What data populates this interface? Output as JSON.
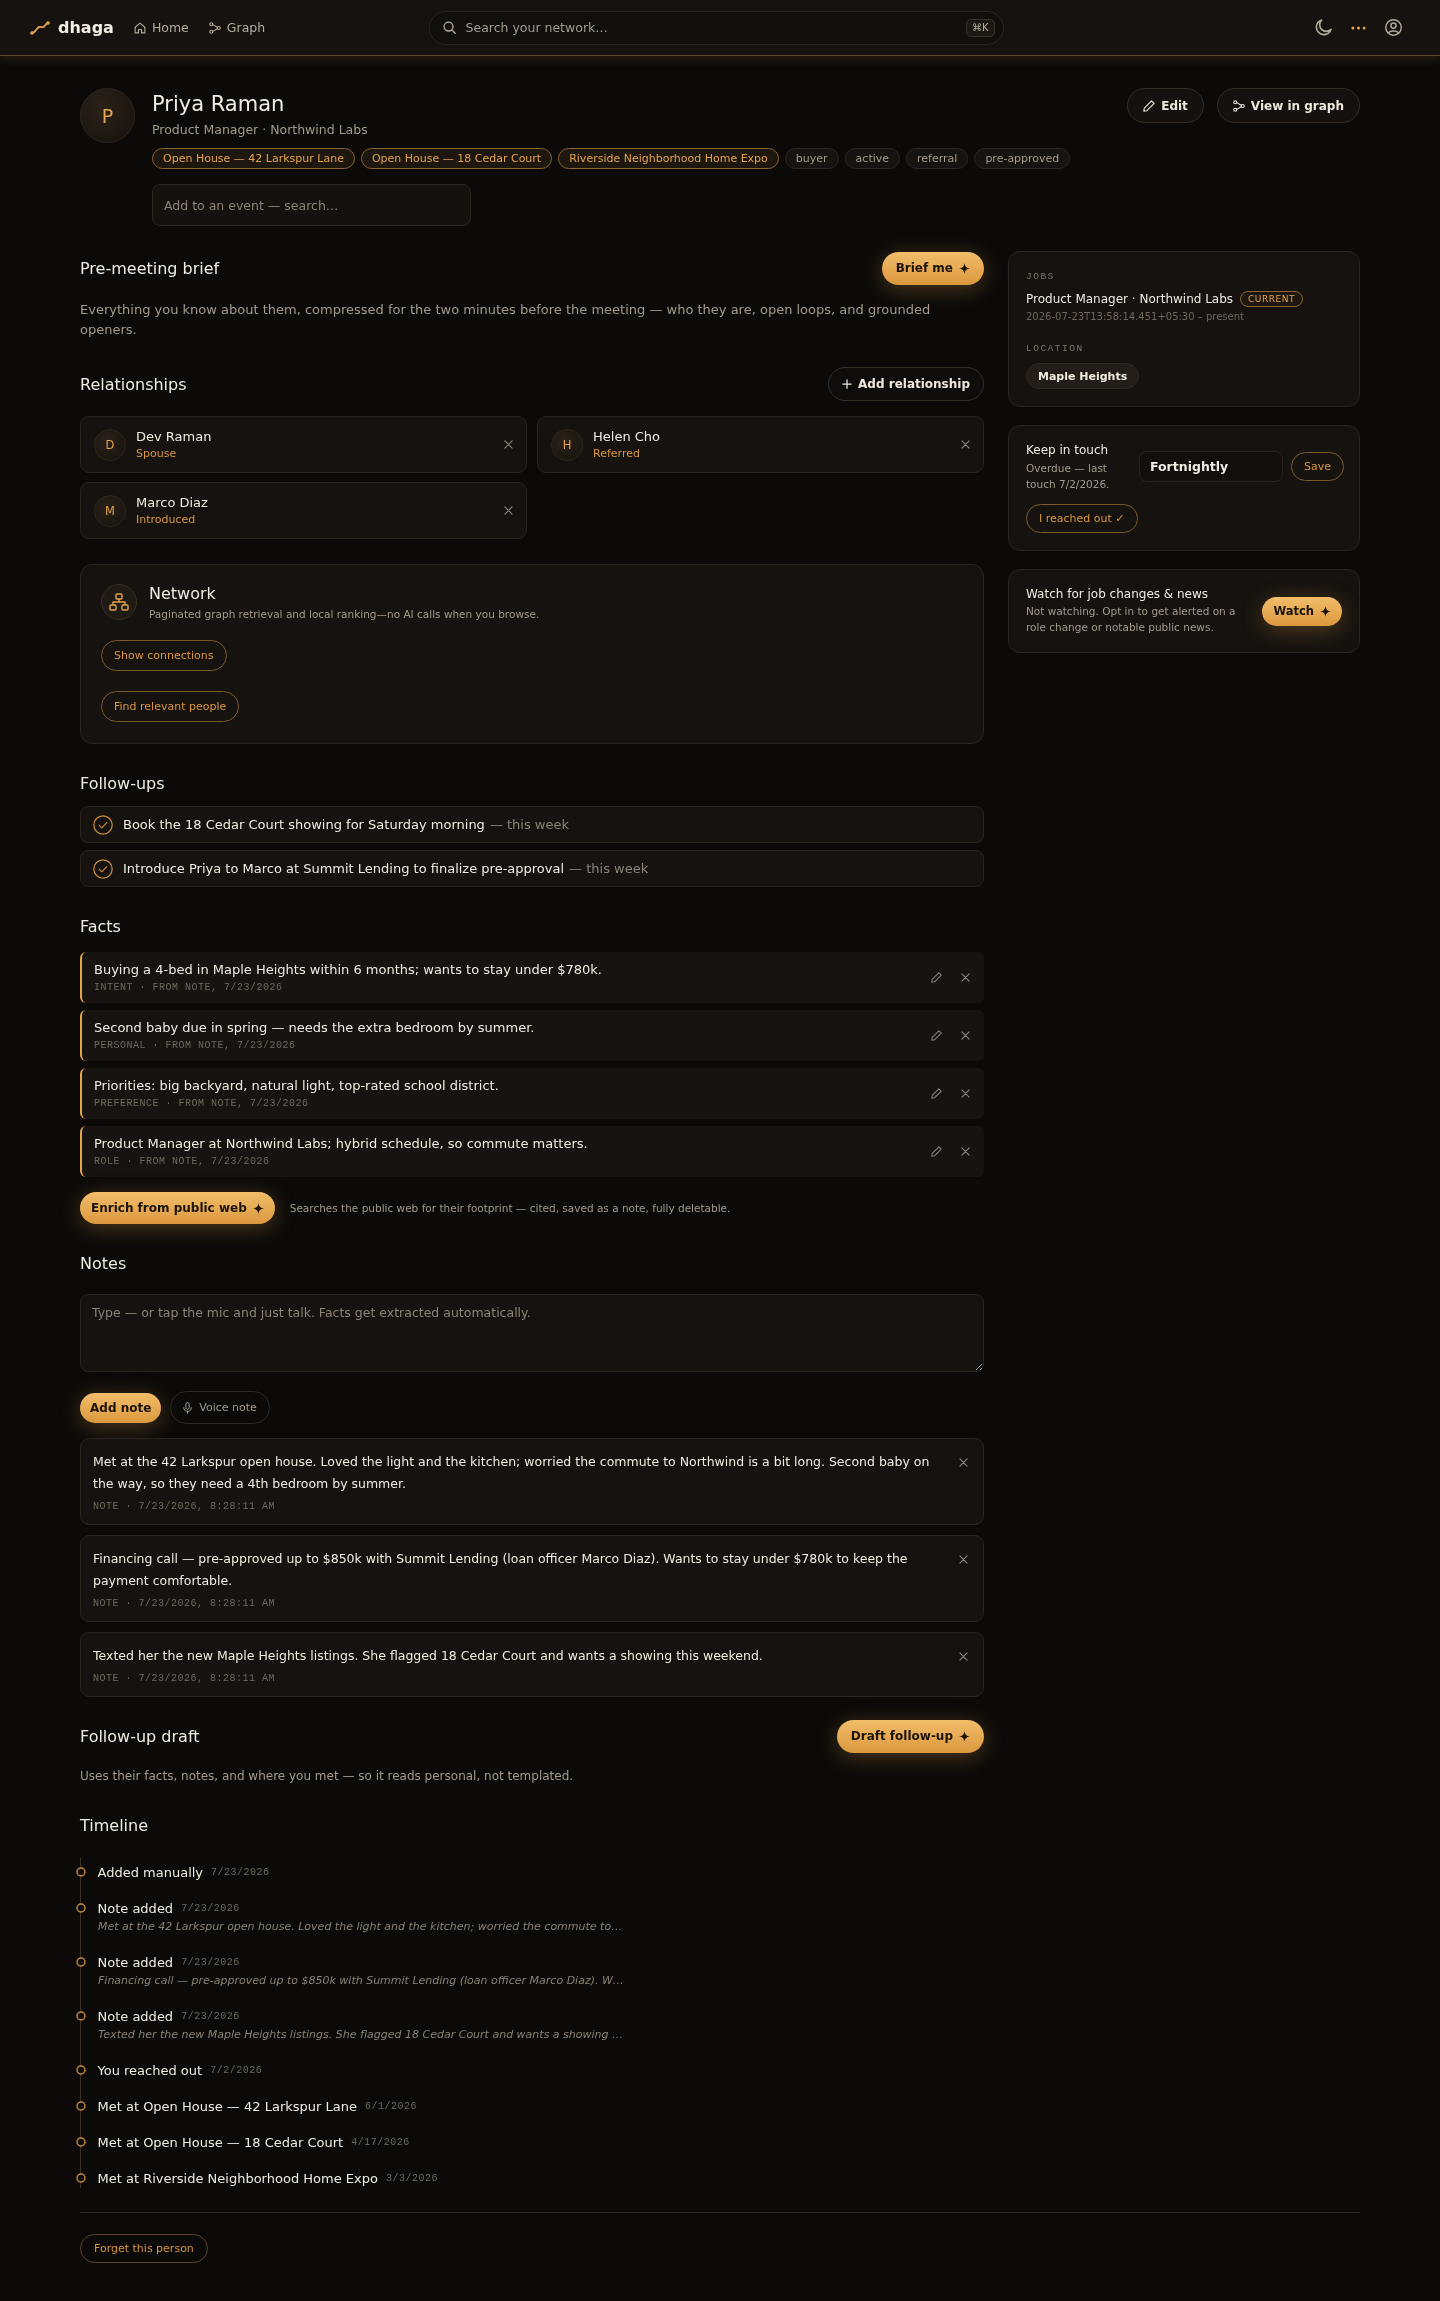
{
  "nav": {
    "logo": "dhaga",
    "links": [
      {
        "label": "Home",
        "kind": "home"
      },
      {
        "label": "Graph",
        "kind": "graph"
      }
    ],
    "search": {
      "placeholder": "Search your network…",
      "shortcut": "⌘K"
    }
  },
  "profile": {
    "initial": "P",
    "name": "Priya Raman",
    "subtitle": "Product Manager · Northwind Labs",
    "actions": [
      {
        "label": "Edit",
        "kind": "edit"
      },
      {
        "label": "View in graph",
        "kind": "graph"
      }
    ],
    "tags": [
      {
        "label": "Open House — 42 Larkspur Lane",
        "kind": "event"
      },
      {
        "label": "Open House — 18 Cedar Court",
        "kind": "event"
      },
      {
        "label": "Riverside Neighborhood Home Expo",
        "kind": "event"
      },
      {
        "label": "buyer",
        "kind": "tag"
      },
      {
        "label": "active",
        "kind": "tag"
      },
      {
        "label": "referral",
        "kind": "tag"
      },
      {
        "label": "pre-approved",
        "kind": "tag"
      }
    ],
    "event_search": {
      "placeholder": "Add to an event — search…"
    }
  },
  "brief": {
    "title": "Pre-meeting brief",
    "button": "Brief me",
    "description": "Everything you know about them, compressed for the two minutes before the meeting — who they are, open loops, and grounded openers."
  },
  "relationships": {
    "title": "Relationships",
    "button": "Add relationship",
    "items": [
      {
        "initial": "D",
        "name": "Dev Raman",
        "relation": "Spouse"
      },
      {
        "initial": "H",
        "name": "Helen Cho",
        "relation": "Referred"
      },
      {
        "initial": "M",
        "name": "Marco Diaz",
        "relation": "Introduced"
      }
    ]
  },
  "network": {
    "title": "Network",
    "description": "Paginated graph retrieval and local ranking—no AI calls when you browse.",
    "buttons": [
      "Show connections",
      "Find relevant people"
    ]
  },
  "followups": {
    "title": "Follow-ups",
    "items": [
      {
        "text": "Book the 18 Cedar Court showing for Saturday morning",
        "due": "— this week"
      },
      {
        "text": "Introduce Priya to Marco at Summit Lending to finalize pre-approval",
        "due": "— this week"
      }
    ]
  },
  "facts": {
    "title": "Facts",
    "items": [
      {
        "text": "Buying a 4-bed in Maple Heights within 6 months; wants to stay under $780k.",
        "meta": "INTENT · FROM NOTE, 7/23/2026"
      },
      {
        "text": "Second baby due in spring — needs the extra bedroom by summer.",
        "meta": "PERSONAL · FROM NOTE, 7/23/2026"
      },
      {
        "text": "Priorities: big backyard, natural light, top-rated school district.",
        "meta": "PREFERENCE · FROM NOTE, 7/23/2026"
      },
      {
        "text": "Product Manager at Northwind Labs; hybrid schedule, so commute matters.",
        "meta": "ROLE · FROM NOTE, 7/23/2026"
      }
    ],
    "enrich": {
      "button": "Enrich from public web",
      "note": "Searches the public web for their footprint — cited, saved as a note, fully deletable."
    }
  },
  "notes": {
    "title": "Notes",
    "placeholder": "Type — or tap the mic and just talk. Facts get extracted automatically.",
    "add_button": "Add note",
    "voice_button": "Voice note",
    "items": [
      {
        "text": "Met at the 42 Larkspur open house. Loved the light and the kitchen; worried the commute to Northwind is a bit long. Second baby on the way, so they need a 4th bedroom by summer.",
        "meta": "NOTE · 7/23/2026, 8:28:11 AM"
      },
      {
        "text": "Financing call — pre-approved up to $850k with Summit Lending (loan officer Marco Diaz). Wants to stay under $780k to keep the payment comfortable.",
        "meta": "NOTE · 7/23/2026, 8:28:11 AM"
      },
      {
        "text": "Texted her the new Maple Heights listings. She flagged 18 Cedar Court and wants a showing this weekend.",
        "meta": "NOTE · 7/23/2026, 8:28:11 AM"
      }
    ]
  },
  "draft": {
    "title": "Follow-up draft",
    "button": "Draft follow-up",
    "description": "Uses their facts, notes, and where you met — so it reads personal, not templated."
  },
  "timeline": {
    "title": "Timeline",
    "items": [
      {
        "title": "Added manually",
        "date": "7/23/2026"
      },
      {
        "title": "Note added",
        "date": "7/23/2026",
        "excerpt": "Met at the 42 Larkspur open house. Loved the light and the kitchen; worried the commute to…"
      },
      {
        "title": "Note added",
        "date": "7/23/2026",
        "excerpt": "Financing call — pre-approved up to $850k with Summit Lending (loan officer Marco Diaz). W…"
      },
      {
        "title": "Note added",
        "date": "7/23/2026",
        "excerpt": "Texted her the new Maple Heights listings. She flagged 18 Cedar Court and wants a showing …"
      },
      {
        "title": "You reached out",
        "date": "7/2/2026"
      },
      {
        "title": "Met at Open House — 42 Larkspur Lane",
        "date": "6/1/2026"
      },
      {
        "title": "Met at Open House — 18 Cedar Court",
        "date": "4/17/2026"
      },
      {
        "title": "Met at Riverside Neighborhood Home Expo",
        "date": "3/3/2026"
      }
    ]
  },
  "sidebar": {
    "jobs": {
      "label": "JOBS",
      "items": [
        {
          "title": "Product Manager · Northwind Labs",
          "badge": "CURRENT",
          "dates": "2026-07-23T13:58:14.451+05:30 – present"
        }
      ]
    },
    "location": {
      "label": "LOCATION",
      "value": "Maple Heights"
    },
    "keep_in_touch": {
      "title": "Keep in touch",
      "status": "Overdue — last touch 7/2/2026.",
      "frequency": "Fortnightly",
      "save": "Save",
      "reached_out": "I reached out ✓"
    },
    "watch": {
      "title": "Watch for job changes & news",
      "description": "Not watching. Opt in to get alerted on a role change or notable public news.",
      "button": "Watch"
    }
  },
  "footer": {
    "button": "Forget this person"
  }
}
